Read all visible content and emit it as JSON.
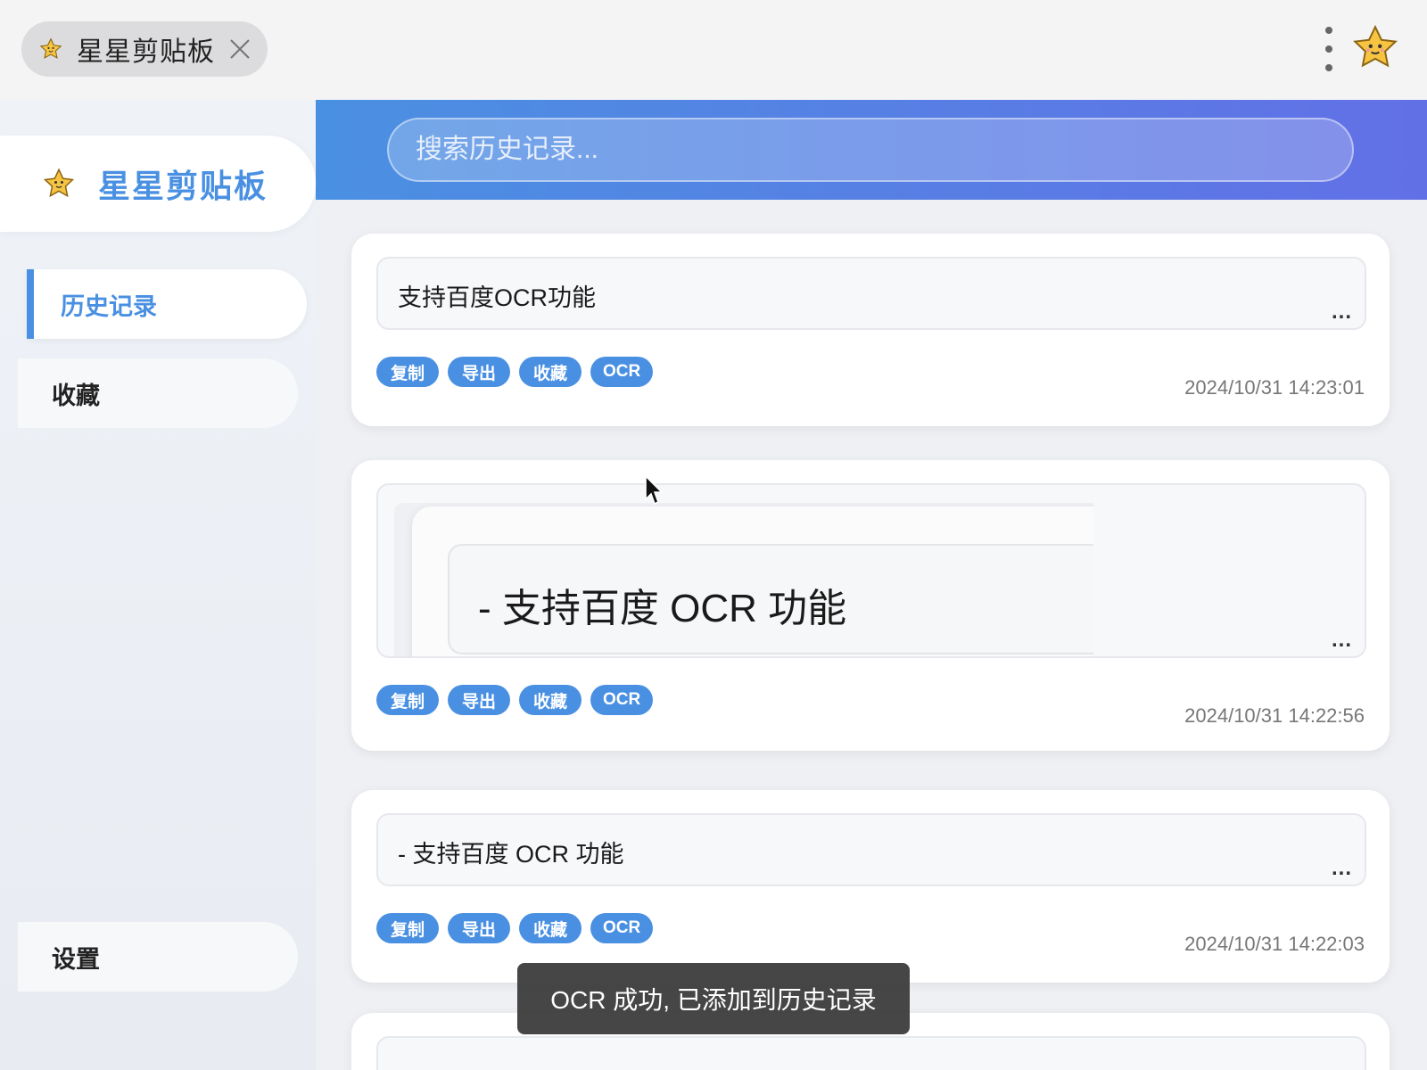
{
  "window": {
    "tab_title": "星星剪贴板"
  },
  "sidebar": {
    "brand": "星星剪贴板",
    "items": [
      {
        "label": "历史记录",
        "active": true
      },
      {
        "label": "收藏",
        "active": false
      }
    ],
    "settings_label": "设置"
  },
  "search": {
    "placeholder": "搜索历史记录..."
  },
  "actions": [
    "复制",
    "导出",
    "收藏",
    "OCR"
  ],
  "cards": [
    {
      "type": "text",
      "content": "支持百度OCR功能",
      "timestamp": "2024/10/31 14:23:01",
      "more": "..."
    },
    {
      "type": "image",
      "content": "- 支持百度 OCR 功能",
      "timestamp": "2024/10/31 14:22:56",
      "more": "..."
    },
    {
      "type": "text",
      "content": "- 支持百度 OCR 功能",
      "timestamp": "2024/10/31 14:22:03",
      "more": "..."
    }
  ],
  "toast": "OCR 成功, 已添加到历史记录",
  "colors": {
    "accent": "#4a90e2",
    "header_gradient_start": "#4a90e2",
    "header_gradient_end": "#6270e6",
    "toast_bg": "#3c3c3c"
  },
  "icons": [
    "star-icon",
    "close-icon",
    "more-vert-icon",
    "star-avatar-icon",
    "more-dots-icon",
    "cursor-icon"
  ]
}
